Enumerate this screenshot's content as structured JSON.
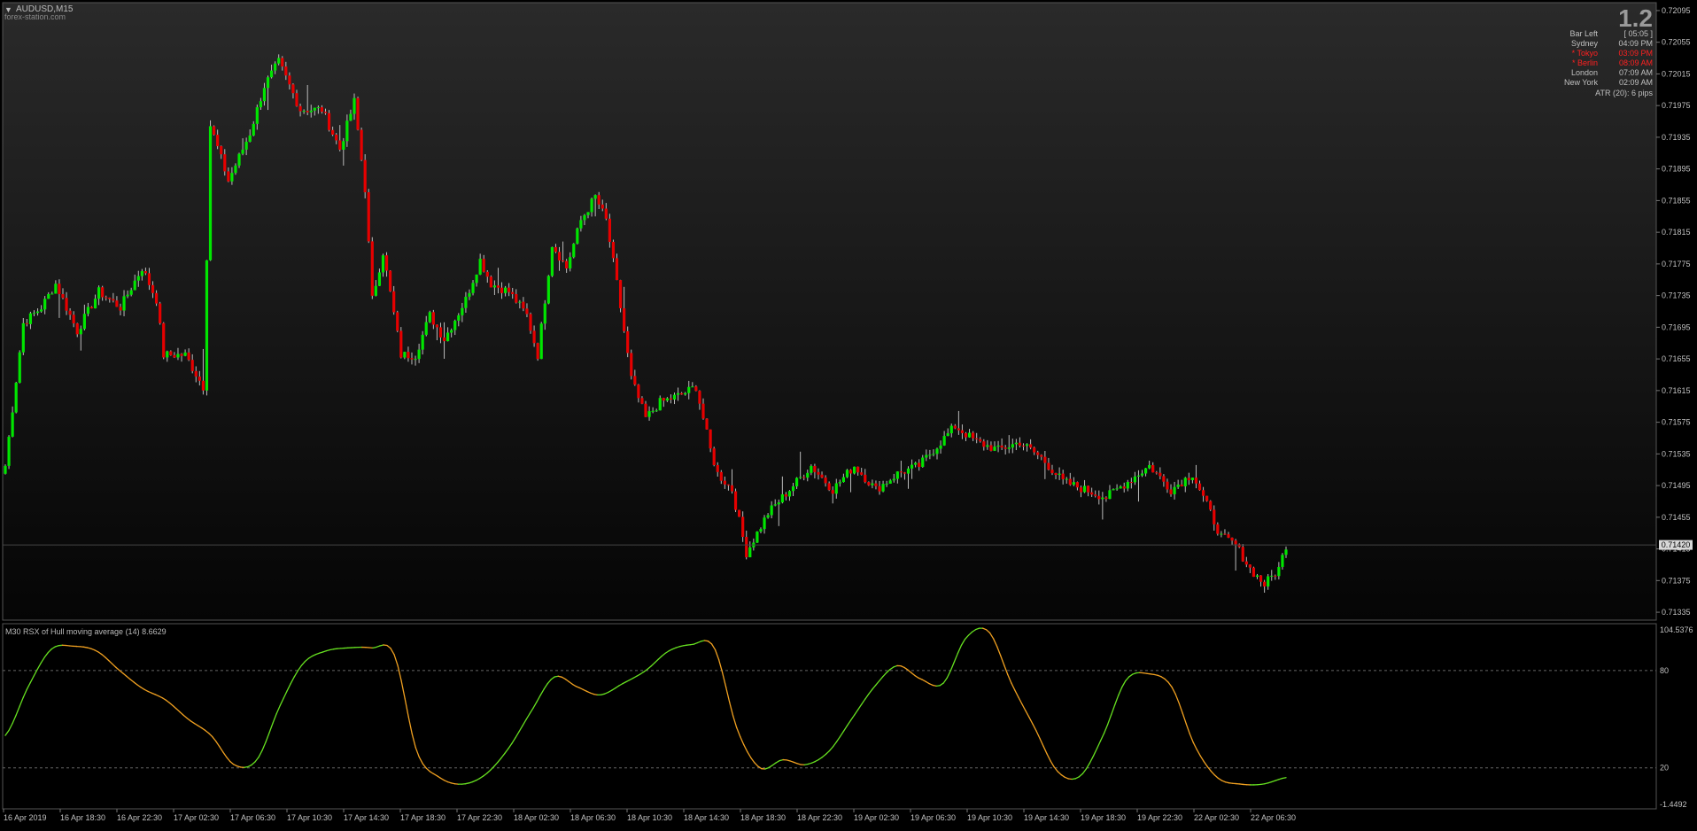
{
  "window": {
    "symbol_title": "AUDUSD,M15",
    "watermark": "forex-station.com"
  },
  "info_panel": {
    "big_number": "1.2",
    "rows": [
      {
        "label": "Bar Left",
        "value": "[ 05:05 ]",
        "highlight": false
      },
      {
        "label": "Sydney",
        "value": "04:09 PM",
        "highlight": false
      },
      {
        "label": "* Tokyo",
        "value": "03:09 PM",
        "highlight": true
      },
      {
        "label": "* Berlin",
        "value": "08:09 AM",
        "highlight": true
      },
      {
        "label": "London",
        "value": "07:09 AM",
        "highlight": false
      },
      {
        "label": "New York",
        "value": "02:09 AM",
        "highlight": false
      }
    ],
    "atr": "ATR (20): 6 pips"
  },
  "indicator": {
    "title": "M30 RSX of Hull moving average (14) 8.6629",
    "scale_top": "104.5376",
    "level_high": "80",
    "level_low": "20",
    "scale_bottom": "-1.4492"
  },
  "current_price": "0.71420",
  "colors": {
    "bull": "#00e600",
    "bear": "#e60000",
    "rsx_up": "#66e020",
    "rsx_down": "#f0a020",
    "highlight": "#ff2020",
    "current_price_bg": "#d8d8d8"
  },
  "chart_data": [
    {
      "type": "candlestick",
      "symbol": "AUDUSD",
      "timeframe": "M15",
      "y_ticks": [
        "0.72095",
        "0.72055",
        "0.72015",
        "0.71975",
        "0.71935",
        "0.71895",
        "0.71855",
        "0.71815",
        "0.71775",
        "0.71735",
        "0.71695",
        "0.71655",
        "0.71615",
        "0.71575",
        "0.71535",
        "0.71495",
        "0.71455",
        "0.71415",
        "0.71375",
        "0.71335"
      ],
      "ylim": [
        0.71325,
        0.72105
      ],
      "x_labels": [
        "16 Apr 2019",
        "16 Apr 18:30",
        "16 Apr 22:30",
        "17 Apr 02:30",
        "17 Apr 06:30",
        "17 Apr 10:30",
        "17 Apr 14:30",
        "17 Apr 18:30",
        "17 Apr 22:30",
        "18 Apr 02:30",
        "18 Apr 06:30",
        "18 Apr 10:30",
        "18 Apr 14:30",
        "18 Apr 18:30",
        "18 Apr 22:30",
        "19 Apr 02:30",
        "19 Apr 06:30",
        "19 Apr 10:30",
        "19 Apr 14:30",
        "19 Apr 18:30",
        "19 Apr 22:30",
        "22 Apr 02:30",
        "22 Apr 06:30"
      ],
      "close_anchors": [
        [
          0,
          0.7152
        ],
        [
          5,
          0.717
        ],
        [
          10,
          0.7172
        ],
        [
          14,
          0.7175
        ],
        [
          20,
          0.7169
        ],
        [
          26,
          0.7174
        ],
        [
          32,
          0.7172
        ],
        [
          38,
          0.7177
        ],
        [
          42,
          0.7173
        ],
        [
          44,
          0.7166
        ],
        [
          50,
          0.7166
        ],
        [
          55,
          0.7162
        ],
        [
          57,
          0.7195
        ],
        [
          62,
          0.7188
        ],
        [
          68,
          0.7194
        ],
        [
          72,
          0.72
        ],
        [
          76,
          0.7203
        ],
        [
          82,
          0.7197
        ],
        [
          88,
          0.7197
        ],
        [
          93,
          0.7192
        ],
        [
          97,
          0.7198
        ],
        [
          100,
          0.7187
        ],
        [
          102,
          0.7173
        ],
        [
          105,
          0.7179
        ],
        [
          110,
          0.7166
        ],
        [
          114,
          0.7166
        ],
        [
          118,
          0.7171
        ],
        [
          122,
          0.7168
        ],
        [
          128,
          0.7173
        ],
        [
          132,
          0.7178
        ],
        [
          135,
          0.7175
        ],
        [
          140,
          0.7174
        ],
        [
          145,
          0.7171
        ],
        [
          148,
          0.7166
        ],
        [
          152,
          0.718
        ],
        [
          156,
          0.7177
        ],
        [
          160,
          0.7183
        ],
        [
          164,
          0.7186
        ],
        [
          167,
          0.7183
        ],
        [
          170,
          0.7175
        ],
        [
          174,
          0.7163
        ],
        [
          178,
          0.7158
        ],
        [
          182,
          0.716
        ],
        [
          188,
          0.7161
        ],
        [
          192,
          0.7162
        ],
        [
          196,
          0.7154
        ],
        [
          198,
          0.7151
        ],
        [
          202,
          0.7149
        ],
        [
          206,
          0.7141
        ],
        [
          212,
          0.7146
        ],
        [
          218,
          0.7149
        ],
        [
          224,
          0.7152
        ],
        [
          230,
          0.7149
        ],
        [
          236,
          0.7152
        ],
        [
          242,
          0.7149
        ],
        [
          248,
          0.7151
        ],
        [
          254,
          0.7152
        ],
        [
          258,
          0.7154
        ],
        [
          264,
          0.7157
        ],
        [
          270,
          0.7155
        ],
        [
          276,
          0.7154
        ],
        [
          282,
          0.7155
        ],
        [
          288,
          0.7153
        ],
        [
          294,
          0.715
        ],
        [
          300,
          0.7149
        ],
        [
          306,
          0.7148
        ],
        [
          312,
          0.715
        ],
        [
          318,
          0.7152
        ],
        [
          324,
          0.7149
        ],
        [
          330,
          0.7151
        ],
        [
          334,
          0.7147
        ],
        [
          338,
          0.7143
        ],
        [
          342,
          0.7142
        ],
        [
          346,
          0.7139
        ],
        [
          350,
          0.7137
        ],
        [
          354,
          0.7139
        ],
        [
          356,
          0.7142
        ]
      ]
    },
    {
      "type": "line",
      "name": "M30 RSX of Hull moving average (14)",
      "ylim": [
        -1.4492,
        104.5376
      ],
      "levels": [
        80,
        20
      ],
      "x": [
        0,
        4,
        10,
        15,
        18,
        30,
        38,
        48,
        52,
        54,
        58,
        66,
        72,
        80,
        88,
        92,
        96,
        100,
        112,
        120,
        128,
        138,
        144,
        148,
        154,
        162,
        170,
        174,
        180,
        186,
        190,
        200,
        210,
        220,
        232,
        236,
        242,
        252,
        260,
        270,
        280,
        286,
        294,
        302,
        312,
        324,
        336,
        345,
        352,
        356
      ],
      "y": [
        40,
        70,
        93,
        95,
        92,
        80,
        69,
        62,
        50,
        40,
        22,
        25,
        58,
        84,
        92,
        94,
        94,
        90,
        30,
        14,
        10,
        16,
        32,
        55,
        76,
        70,
        65,
        72,
        80,
        92,
        96,
        94,
        44,
        20,
        25,
        22,
        30,
        50,
        70,
        83,
        75,
        72,
        100,
        104,
        72,
        45,
        18,
        15,
        40,
        74,
        78,
        70,
        34,
        14,
        10,
        10,
        14
      ]
    }
  ]
}
